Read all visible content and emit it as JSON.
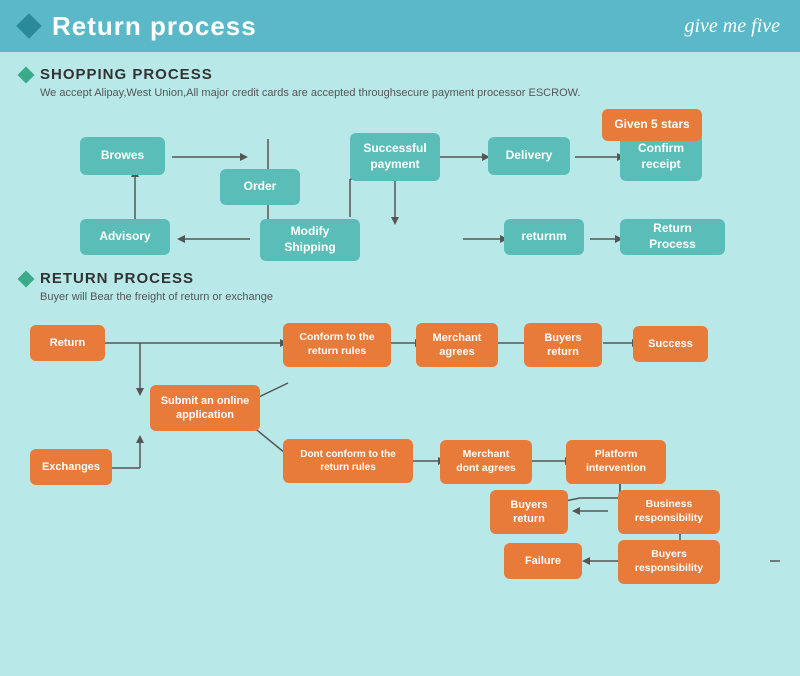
{
  "header": {
    "title": "Return process",
    "brand": "give me five"
  },
  "shopping_section": {
    "title": "SHOPPING PROCESS",
    "desc": "We accept Alipay,West Union,All major credit cards are accepted throughsecure payment processor ESCROW.",
    "boxes": {
      "browes": "Browes",
      "order": "Order",
      "advisory": "Advisory",
      "modify_shipping": "Modify\nShipping",
      "successful_payment": "Successful\npayment",
      "delivery": "Delivery",
      "confirm_receipt": "Confirm\nreceipt",
      "given_5_stars": "Given 5 stars",
      "returnm": "returnm",
      "return_process": "Return Process"
    }
  },
  "return_section": {
    "title": "RETURN PROCESS",
    "desc": "Buyer will Bear the freight of return or exchange",
    "boxes": {
      "return": "Return",
      "exchanges": "Exchanges",
      "submit_online": "Submit an online\napplication",
      "conform_return_rules": "Conform to the\nreturn rules",
      "dont_conform_return_rules": "Dont conform to the\nreturn rules",
      "merchant_agrees": "Merchant\nagrees",
      "merchant_dont_agrees": "Merchant\ndont agrees",
      "buyers_return1": "Buyers\nreturn",
      "buyers_return2": "Buyers\nreturn",
      "success": "Success",
      "platform_intervention": "Platform\nintervention",
      "business_responsibility": "Business\nresponsibility",
      "buyers_responsibility": "Buyers\nresponsibility",
      "failure": "Failure"
    }
  }
}
